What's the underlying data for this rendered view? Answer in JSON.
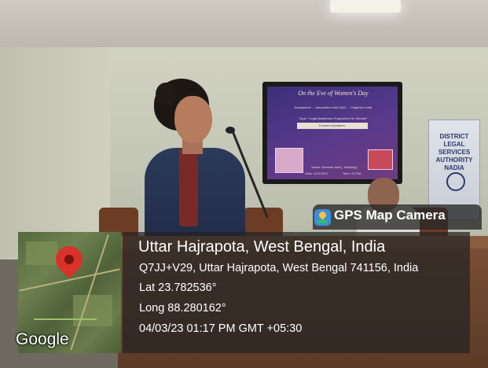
{
  "photo": {
    "screen_title_line1": "On the Eve of",
    "screen_title_line2": "Women's Day",
    "screen_subtitle": "Kanyashree ... Association with IQAC ... Organize a talk",
    "screen_topic": "Topic: \"Legal Awareness Programme for Women\"",
    "screen_speakers_heading": "Eminent Speakers:",
    "screen_venue": "Venue: Seminar Hall (...Building)",
    "screen_date": "Date: 4.03.2023",
    "screen_time": "Time: 12 P.M.",
    "banner_text": "DISTRICT LEGAL SERVICES AUTHORITY NADIA"
  },
  "gps": {
    "app_label": "GPS Map Camera",
    "map_brand": "Google",
    "place": "Uttar Hajrapota, West Bengal, India",
    "address": "Q7JJ+V29, Uttar Hajrapota, West Bengal 741156, India",
    "latitude": "Lat 23.782536°",
    "longitude": "Long 88.280162°",
    "datetime": "04/03/23 01:17 PM GMT +05:30",
    "pin_color": "#d9322b"
  }
}
